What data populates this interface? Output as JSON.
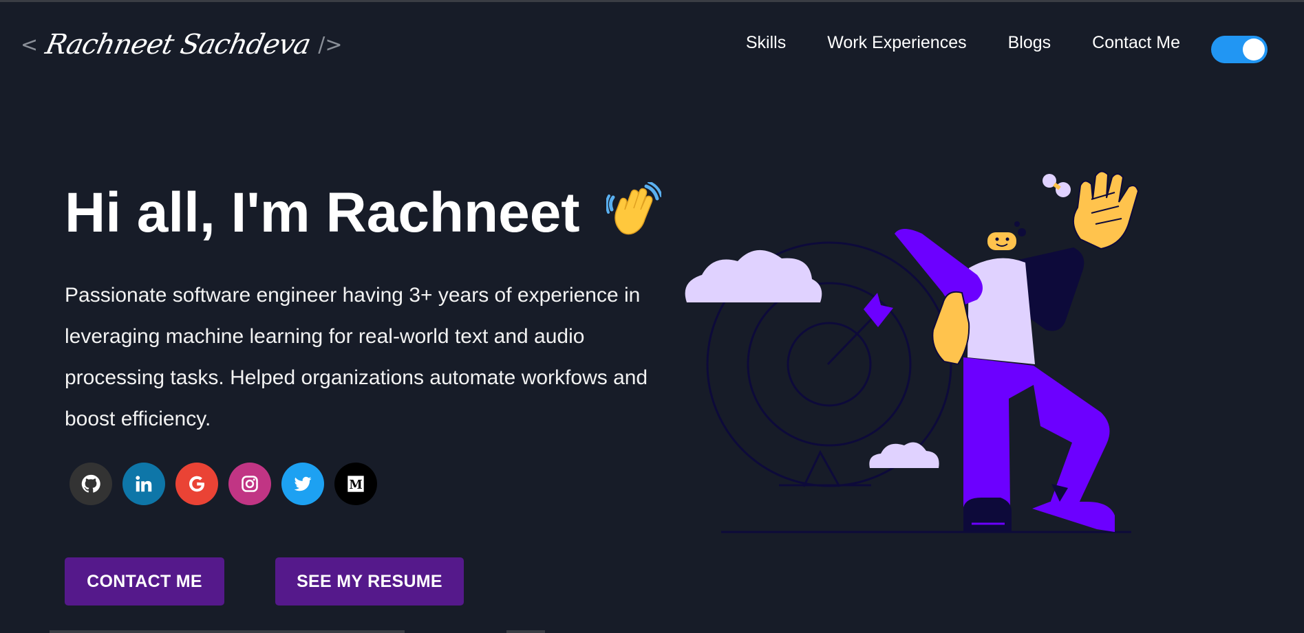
{
  "header": {
    "logo_left_bracket": "<",
    "logo_name": "Rachneet Sachdeva",
    "logo_right_bracket": "/>",
    "nav": [
      {
        "label": "Skills"
      },
      {
        "label": "Work Experiences"
      },
      {
        "label": "Blogs"
      },
      {
        "label": "Contact Me"
      }
    ],
    "theme_toggle_on": true
  },
  "hero": {
    "title": "Hi all, I'm Rachneet",
    "emoji": "👋",
    "subtitle": "Passionate software engineer having 3+ years of experience in leveraging machine learning for real-world text and audio processing tasks. Helped organizations automate workfows and boost efficiency.",
    "socials": [
      {
        "name": "github-icon",
        "color": "#333333"
      },
      {
        "name": "linkedin-icon",
        "color": "#0e76a8"
      },
      {
        "name": "google-icon",
        "color": "#ea4335"
      },
      {
        "name": "instagram-icon",
        "color": "#c13584"
      },
      {
        "name": "twitter-icon",
        "color": "#1da1f2"
      },
      {
        "name": "medium-icon",
        "color": "#000000"
      }
    ],
    "buttons": {
      "contact": "CONTACT ME",
      "resume": "SEE MY RESUME"
    }
  },
  "colors": {
    "background": "#171c28",
    "button": "#55198b",
    "toggle": "#2196f3",
    "illustration_purple": "#6c00ff",
    "illustration_lavender": "#e0d2ff",
    "illustration_yellow": "#ffc34d"
  }
}
